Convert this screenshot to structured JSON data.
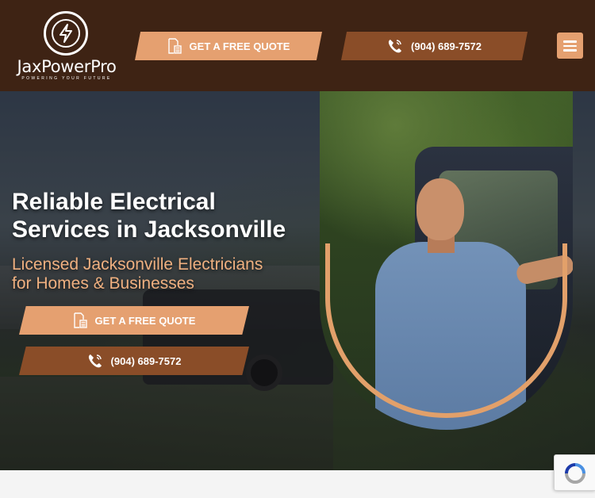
{
  "brand": {
    "name": "JaxPowerPro",
    "tagline": "POWERING YOUR FUTURE"
  },
  "header": {
    "quote_label": "GET A FREE QUOTE",
    "phone_label": "(904) 689-7572"
  },
  "hero": {
    "title_line1": "Reliable Electrical",
    "title_line2": "Services in Jacksonville",
    "subtitle_line1": "Licensed Jacksonville Electricians",
    "subtitle_line2": "for Homes & Businesses",
    "quote_label": "GET A FREE QUOTE",
    "phone_label": "(904) 689-7572"
  },
  "colors": {
    "header_bg": "#3e2314",
    "accent_light": "#e5a070",
    "accent_dark": "#8a4d28",
    "subtitle": "#efb080"
  },
  "icons": {
    "logo": "lightning-bolt-icon",
    "quote": "document-calculator-icon",
    "phone": "phone-ringing-icon",
    "menu": "hamburger-menu-icon",
    "recaptcha": "recaptcha-icon"
  }
}
